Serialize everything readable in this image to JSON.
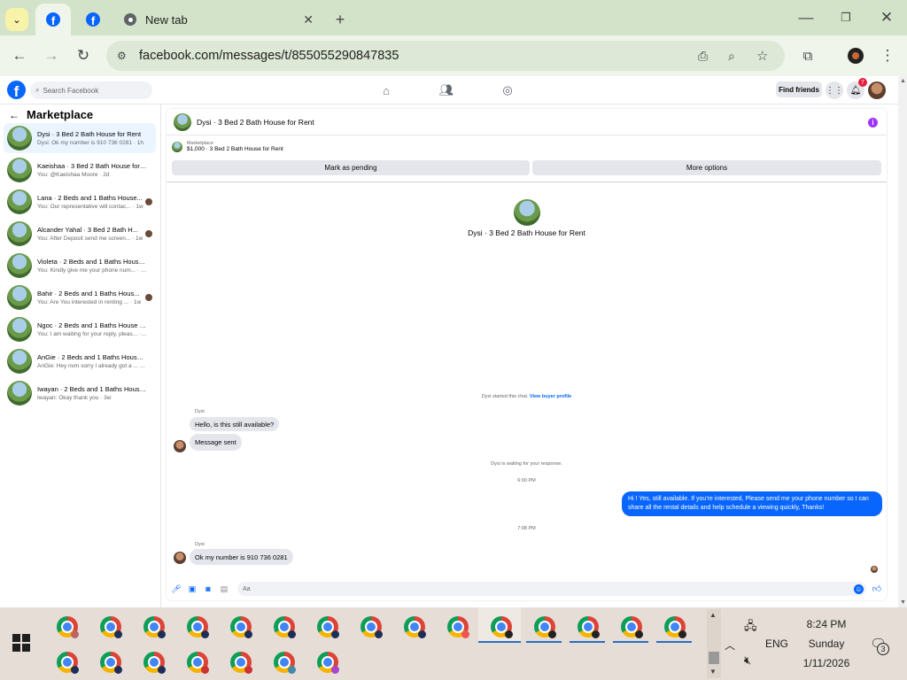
{
  "browser": {
    "tabs": [
      {
        "label": ""
      },
      {
        "label": ""
      },
      {
        "label": "New tab"
      }
    ],
    "url": "facebook.com/messages/t/855055290847835"
  },
  "fb": {
    "search_placeholder": "Search Facebook",
    "find_friends": "Find friends",
    "notif_count": "7"
  },
  "left": {
    "title": "Marketplace",
    "conversations": [
      {
        "name": "Dysi · 3 Bed 2 Bath House for Rent",
        "preview": "Dysi: Ok my number is 910 736 0281 · 1h"
      },
      {
        "name": "Kaeishaa · 3 Bed 2 Bath House for ...",
        "preview": "You: @Kaeishaa Moore · 2d"
      },
      {
        "name": "Lana · 2 Beds and 1 Baths House...",
        "preview": "You: Our representative will contac... · 1w"
      },
      {
        "name": "Alcander Yahal · 3 Bed 2 Bath H...",
        "preview": "You: After Deposit send me screen... · 1w"
      },
      {
        "name": "Violeta · 2 Beds and 1 Baths House...",
        "preview": "You: Kindly give me your phone num... · 1w"
      },
      {
        "name": "Bahir · 2 Beds and 1 Baths Hous...",
        "preview": "You: Are You interested in renting ... · 1w"
      },
      {
        "name": "Ngoc · 2 Beds and 1 Baths House F...",
        "preview": "You: I am waiting for your reply, pleas... · 2w"
      },
      {
        "name": "AnGie · 2 Beds and 1 Baths House ...",
        "preview": "AnGie: Hey nvm sorry I already got a ... · 3w"
      },
      {
        "name": "Iwayan · 2 Beds and 1 Baths House...",
        "preview": "Iwayan: Okay thank you · 3w"
      }
    ]
  },
  "chat": {
    "title": "Dysi · 3 Bed 2 Bath House for Rent",
    "marketplace_label": "Marketplace",
    "listing": "$1,000 · 3 Bed 2 Bath House for Rent",
    "mark_pending": "Mark as pending",
    "more_options": "More options",
    "center_title": "Dysi · 3 Bed 2 Bath House for Rent",
    "started": "Dysi started this chat.",
    "view_profile": "View buyer profile",
    "sender1": "Dysi",
    "msg1": "Hello, is this still available?",
    "msg2": "Message sent",
    "waiting": "Dysi is waiting for your response.",
    "time1": "6:00 PM",
    "out_msg": "Hi ! Yes, still available. If you're interested, Please send me your phone number so I can share all the rental details and help schedule a viewing quickly, Thanks!",
    "time2": "7:08 PM",
    "sender2": "Dysi",
    "msg3": "Ok my number is 910 736 0281",
    "composer_placeholder": "Aa"
  },
  "taskbar": {
    "lang": "ENG",
    "time": "8:24 PM",
    "day": "Sunday",
    "date": "1/11/2026",
    "notif": "3"
  }
}
